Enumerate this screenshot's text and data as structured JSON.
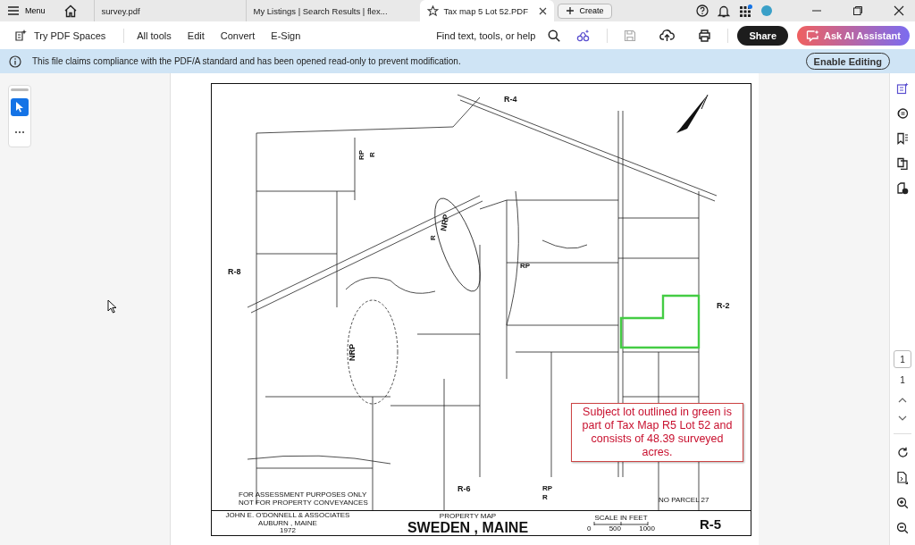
{
  "title_bar": {
    "menu_label": "Menu",
    "tabs": [
      {
        "label": "survey.pdf",
        "selected": false
      },
      {
        "label": "My Listings | Search Results | flex...",
        "selected": false
      },
      {
        "label": "Tax map 5 Lot 52.PDF",
        "selected": true
      }
    ],
    "create_label": "Create",
    "notification_badge": true
  },
  "toolbar": {
    "spaces_label": "Try PDF Spaces",
    "menu": [
      "All tools",
      "Edit",
      "Convert",
      "E-Sign"
    ],
    "search_placeholder": "Find text, tools, or help",
    "share_label": "Share",
    "ai_label": "Ask AI Assistant"
  },
  "banner": {
    "message": "This file claims compliance with the PDF/A standard and has been opened read-only to prevent modification.",
    "button": "Enable Editing"
  },
  "tool_panel": {
    "tools": [
      {
        "kind": "select",
        "selected": true
      },
      {
        "kind": "more",
        "selected": false
      }
    ]
  },
  "document": {
    "zone_labels": [
      "R-4",
      "R-2",
      "R-8",
      "R-6",
      "NRP",
      "NRP",
      "RP",
      "RP",
      "RP",
      "R",
      "R",
      "R"
    ],
    "notes": [
      "FOR ASSESSMENT PURPOSES ONLY",
      "NOT FOR PROPERTY CONVEYANCES"
    ],
    "no_parcel": "NO PARCEL 27",
    "firm": [
      "JOHN E. O'DONNELL & ASSOCIATES",
      "AUBURN , MAINE",
      "1972"
    ],
    "map_kind": "PROPERTY MAP",
    "town": "SWEDEN , MAINE",
    "scale_label": "SCALE IN FEET",
    "scale_ticks": [
      "0",
      "500",
      "1000"
    ],
    "sheet": "R-5",
    "annotation": "Subject lot outlined in green is part of Tax Map R5 Lot 52 and consists of 48.39 surveyed acres."
  },
  "page_nav": {
    "current": "1",
    "total": "1"
  }
}
